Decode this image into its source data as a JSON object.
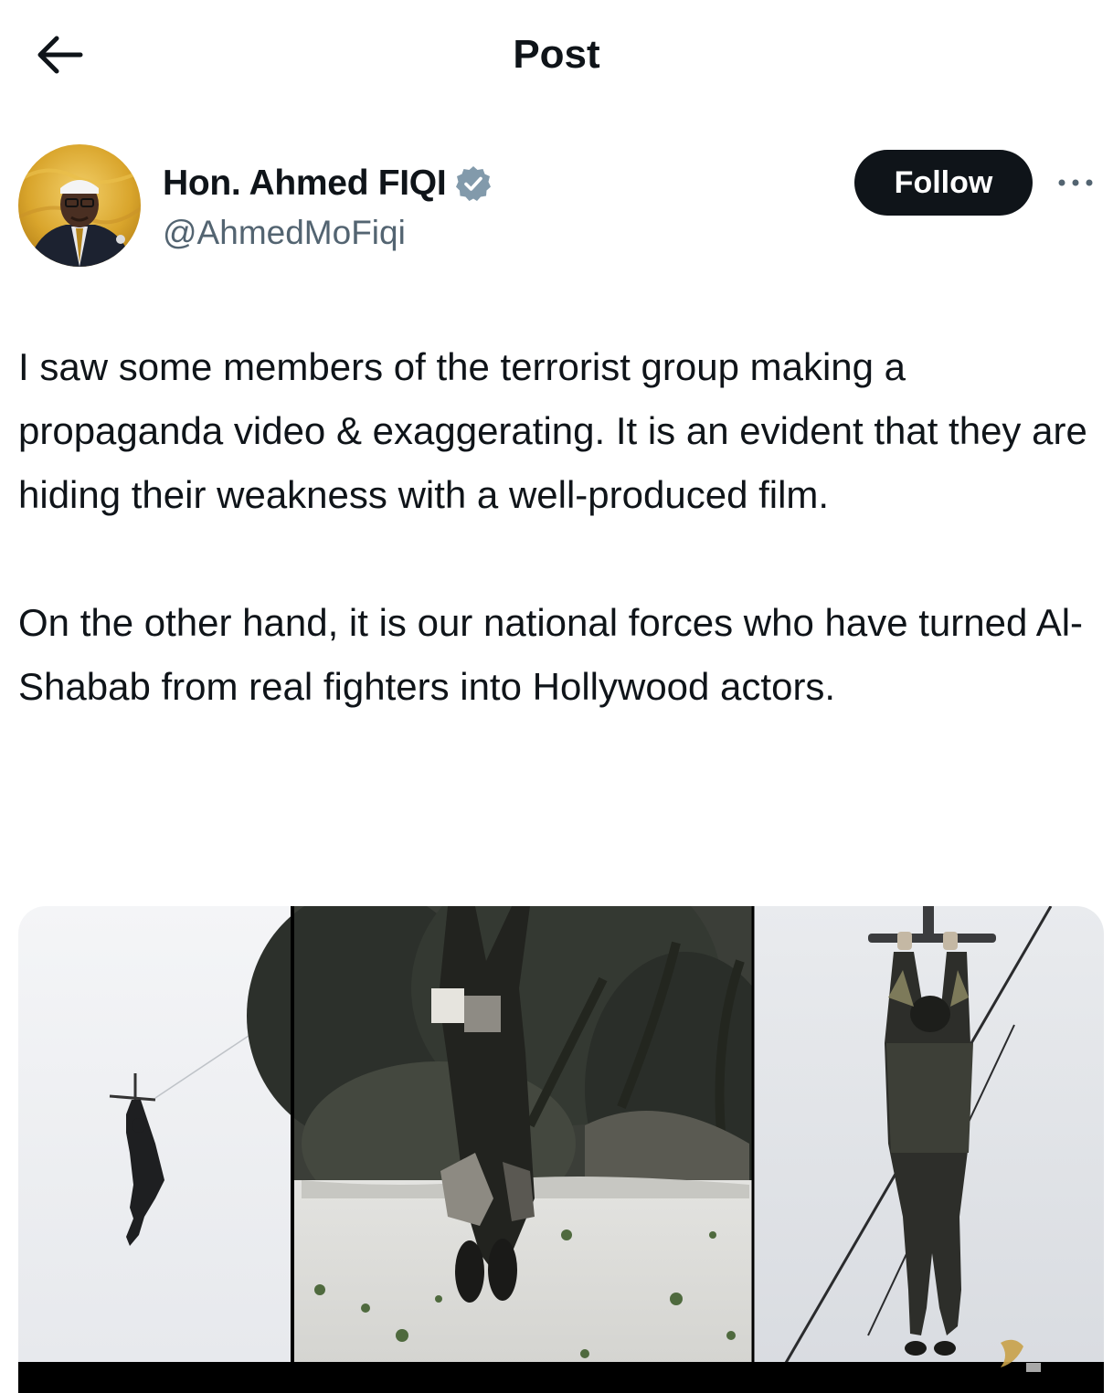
{
  "header": {
    "title": "Post",
    "back_icon": "arrow-left-icon"
  },
  "author": {
    "name": "Hon. Ahmed FIQI",
    "handle": "@AhmedMoFiqi",
    "verified": true,
    "badge_color": "#829aab"
  },
  "actions": {
    "follow_label": "Follow",
    "more_icon": "more-horizontal-icon"
  },
  "post": {
    "paragraphs": [
      "I saw some members of the terrorist group making a propaganda video & exaggerating. It is an evident that they are hiding their weakness with a well-produced film.",
      "On the other hand, it is our national forces who have turned Al-Shabab from real fighters into Hollywood actors."
    ]
  },
  "media": {
    "panels": 3
  }
}
